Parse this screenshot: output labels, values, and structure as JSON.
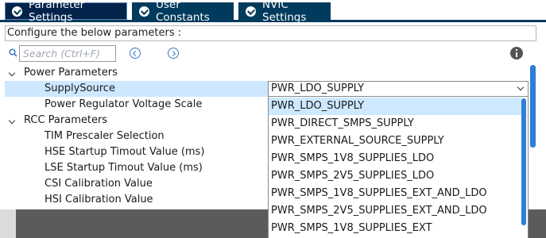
{
  "tabs": [
    {
      "label": "Parameter Settings",
      "active": true
    },
    {
      "label": "User Constants",
      "active": false
    },
    {
      "label": "NVIC Settings",
      "active": false
    }
  ],
  "config_label": "Configure the below parameters :",
  "search": {
    "placeholder": "Search (Ctrl+F)"
  },
  "tree": {
    "power_group": "Power Parameters",
    "supply_source_label": "SupplySource",
    "supply_source_value": "PWR_LDO_SUPPLY",
    "voltage_scale_label": "Power Regulator Voltage Scale",
    "rcc_group": "RCC Parameters",
    "rcc_items": [
      "TIM Prescaler Selection",
      "HSE Startup Timout Value (ms)",
      "LSE Startup Timout Value (ms)",
      "CSI Calibration Value",
      "HSI Calibration Value"
    ]
  },
  "dropdown_options": [
    "PWR_LDO_SUPPLY",
    "PWR_DIRECT_SMPS_SUPPLY",
    "PWR_EXTERNAL_SOURCE_SUPPLY",
    "PWR_SMPS_1V8_SUPPLIES_LDO",
    "PWR_SMPS_2V5_SUPPLIES_LDO",
    "PWR_SMPS_1V8_SUPPLIES_EXT_AND_LDO",
    "PWR_SMPS_2V5_SUPPLIES_EXT_AND_LDO",
    "PWR_SMPS_1V8_SUPPLIES_EXT"
  ],
  "colors": {
    "tab_bg": "#003a5c",
    "selection": "#cde8ff",
    "scrollbar": "#2f7ed8"
  },
  "icons": [
    "check-circle-icon",
    "search-icon",
    "previous-icon",
    "next-icon",
    "info-icon",
    "chevron-down-icon"
  ]
}
